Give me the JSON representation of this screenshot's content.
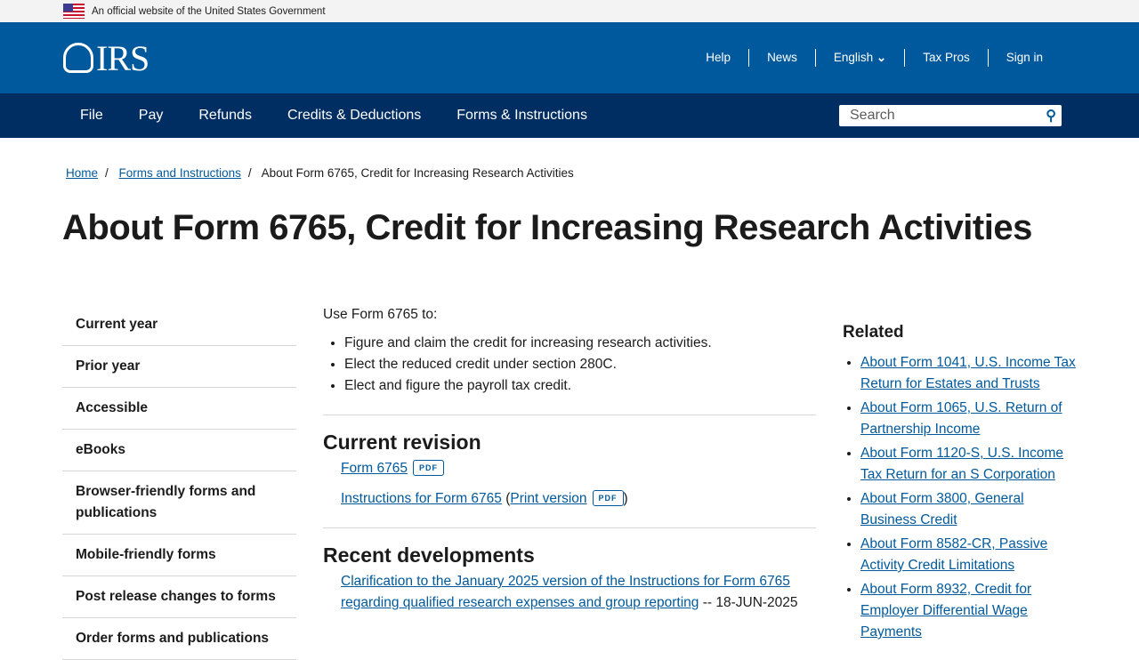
{
  "banner": {
    "text": "An official website of the United States Government"
  },
  "header": {
    "logo": "IRS",
    "util": [
      "Help",
      "News",
      "English",
      "Tax Pros",
      "Sign in"
    ]
  },
  "nav": {
    "items": [
      "File",
      "Pay",
      "Refunds",
      "Credits & Deductions",
      "Forms & Instructions"
    ],
    "search_placeholder": "Search"
  },
  "breadcrumb": {
    "home": "Home",
    "forms": "Forms and Instructions",
    "current": "About Form 6765, Credit for Increasing Research Activities"
  },
  "title": "About Form 6765, Credit for Increasing Research Activities",
  "sidebar": [
    "Current year",
    "Prior year",
    "Accessible",
    "eBooks",
    "Browser-friendly forms and publications",
    "Mobile-friendly forms",
    "Post release changes to forms",
    "Order forms and publications"
  ],
  "main": {
    "intro": "Use Form 6765 to:",
    "bullets": [
      "Figure and claim the credit for increasing research activities.",
      "Elect the reduced credit under section 280C.",
      "Elect and figure the payroll tax credit."
    ],
    "current_revision": "Current revision",
    "form_link": "Form 6765",
    "pdf": "PDF",
    "instr_link": "Instructions for Form 6765",
    "print_link": "Print version",
    "recent": "Recent developments",
    "dev_link": "Clarification to the January 2025 version of the Instructions for Form 6765 regarding qualified research expenses and group reporting",
    "dev_date": "-- 18-JUN-2025"
  },
  "related": {
    "title": "Related",
    "links": [
      "About Form 1041, U.S. Income Tax Return for Estates and Trusts",
      "About Form 1065, U.S. Return of Partnership Income",
      "About Form 1120-S, U.S. Income Tax Return for an S Corporation",
      "About Form 3800, General Business Credit",
      "About Form 8582-CR, Passive Activity Credit Limitations",
      "About Form 8932, Credit for Employer Differential Wage Payments"
    ]
  }
}
